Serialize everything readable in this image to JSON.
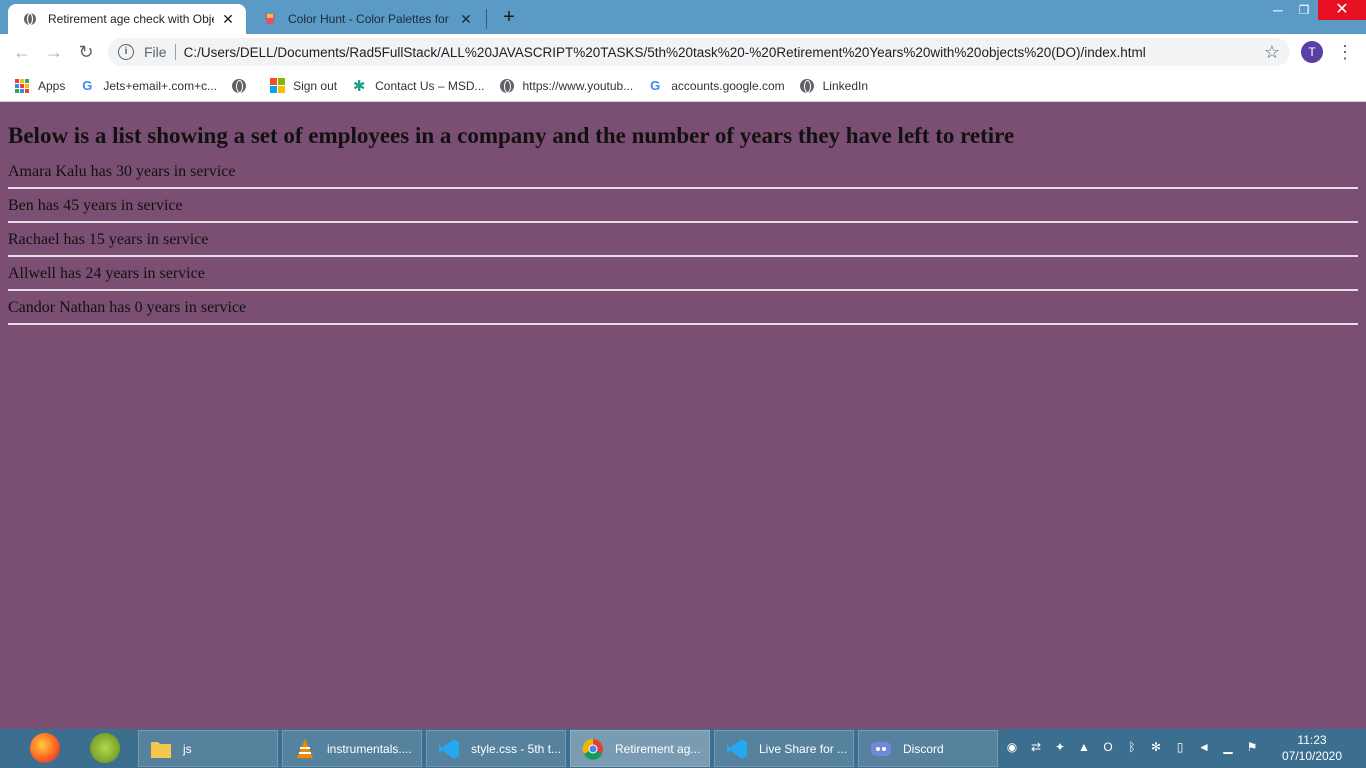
{
  "browser": {
    "tabs": [
      {
        "label": "Retirement age check with Objec",
        "active": true
      },
      {
        "label": "Color Hunt - Color Palettes for D",
        "active": false
      }
    ],
    "new_tab_symbol": "+",
    "window_controls": {
      "minimize": "─",
      "maximize": "❐",
      "close": "✕"
    },
    "toolbar": {
      "file_label": "File",
      "url": "C:/Users/DELL/Documents/Rad5FullStack/ALL%20JAVASCRIPT%20TASKS/5th%20task%20-%20Retirement%20Years%20with%20objects%20(DO)/index.html",
      "profile_initial": "T"
    },
    "bookmarks": [
      {
        "label": "Apps",
        "icon": "apps-grid-icon"
      },
      {
        "label": "Jets+email+.com+c...",
        "icon": "google-icon"
      },
      {
        "label": "",
        "icon": "globe-icon"
      },
      {
        "label": "Sign out",
        "icon": "microsoft-icon"
      },
      {
        "label": "Contact Us – MSD...",
        "icon": "gear-icon"
      },
      {
        "label": "https://www.youtub...",
        "icon": "globe-icon"
      },
      {
        "label": "accounts.google.com",
        "icon": "google-icon"
      },
      {
        "label": "LinkedIn",
        "icon": "globe-icon"
      }
    ]
  },
  "page": {
    "background": "#7b4f74",
    "heading": "Below is a list showing a set of employees in a company and the number of years they have left to retire",
    "employees": [
      "Amara Kalu has 30 years in service",
      "Ben has 45 years in service",
      "Rachael has 15 years in service",
      "Allwell has 24 years in service",
      "Candor Nathan has 0 years in service"
    ]
  },
  "taskbar": {
    "pinned": [
      "firefox-icon",
      "chameleon-icon"
    ],
    "buttons": [
      {
        "label": "js",
        "icon": "folder-icon",
        "active": false
      },
      {
        "label": "instrumentals....",
        "icon": "vlc-icon",
        "active": false
      },
      {
        "label": "style.css - 5th t...",
        "icon": "vscode-icon",
        "active": false
      },
      {
        "label": "Retirement ag...",
        "icon": "chrome-icon",
        "active": true
      },
      {
        "label": "Live Share for ...",
        "icon": "vscode-icon",
        "active": false
      },
      {
        "label": "Discord",
        "icon": "discord-icon",
        "active": false
      }
    ],
    "clock": {
      "time": "11:23",
      "date": "07/10/2020"
    }
  }
}
